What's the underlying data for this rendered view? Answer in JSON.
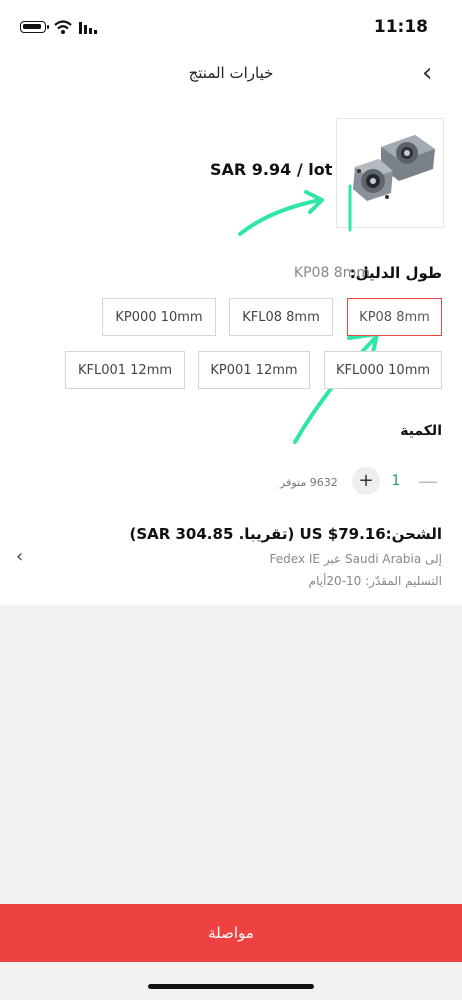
{
  "status_bar": {
    "time": "11:18"
  },
  "header": {
    "title": "خيارات المنتج"
  },
  "product": {
    "price": "SAR 9.94 / lot"
  },
  "options": {
    "label": "طول الدليل:",
    "selected_value": "KP08  8mm",
    "chips": [
      {
        "label": "KP08  8mm",
        "selected": true
      },
      {
        "label": "KFL08  8mm",
        "selected": false
      },
      {
        "label": "KP000  10mm",
        "selected": false
      },
      {
        "label": "KFL000  10mm",
        "selected": false
      },
      {
        "label": "KP001  12mm",
        "selected": false
      },
      {
        "label": "KFL001  12mm",
        "selected": false
      }
    ]
  },
  "quantity": {
    "label": "الكمية",
    "minus": "—",
    "value": "1",
    "plus": "+",
    "stock": "9632 متوفر"
  },
  "shipping": {
    "title": "الشحن:US $79.16 (تقريبا. SAR 304.85)",
    "route": "إلى Saudi Arabia عبر Fedex IE",
    "eta": "التسليم المقدّر: 10-20أيام"
  },
  "footer": {
    "continue_label": "مواصلة"
  },
  "colors": {
    "accent_red": "#ee4142",
    "selected_border": "#e8483a",
    "annotation_arrow": "#2ee6a8",
    "qty_value": "#1e9b55"
  },
  "icons": [
    "battery-icon",
    "wifi-icon",
    "signal-icon",
    "back-chevron-icon",
    "shipping-chevron-icon"
  ]
}
